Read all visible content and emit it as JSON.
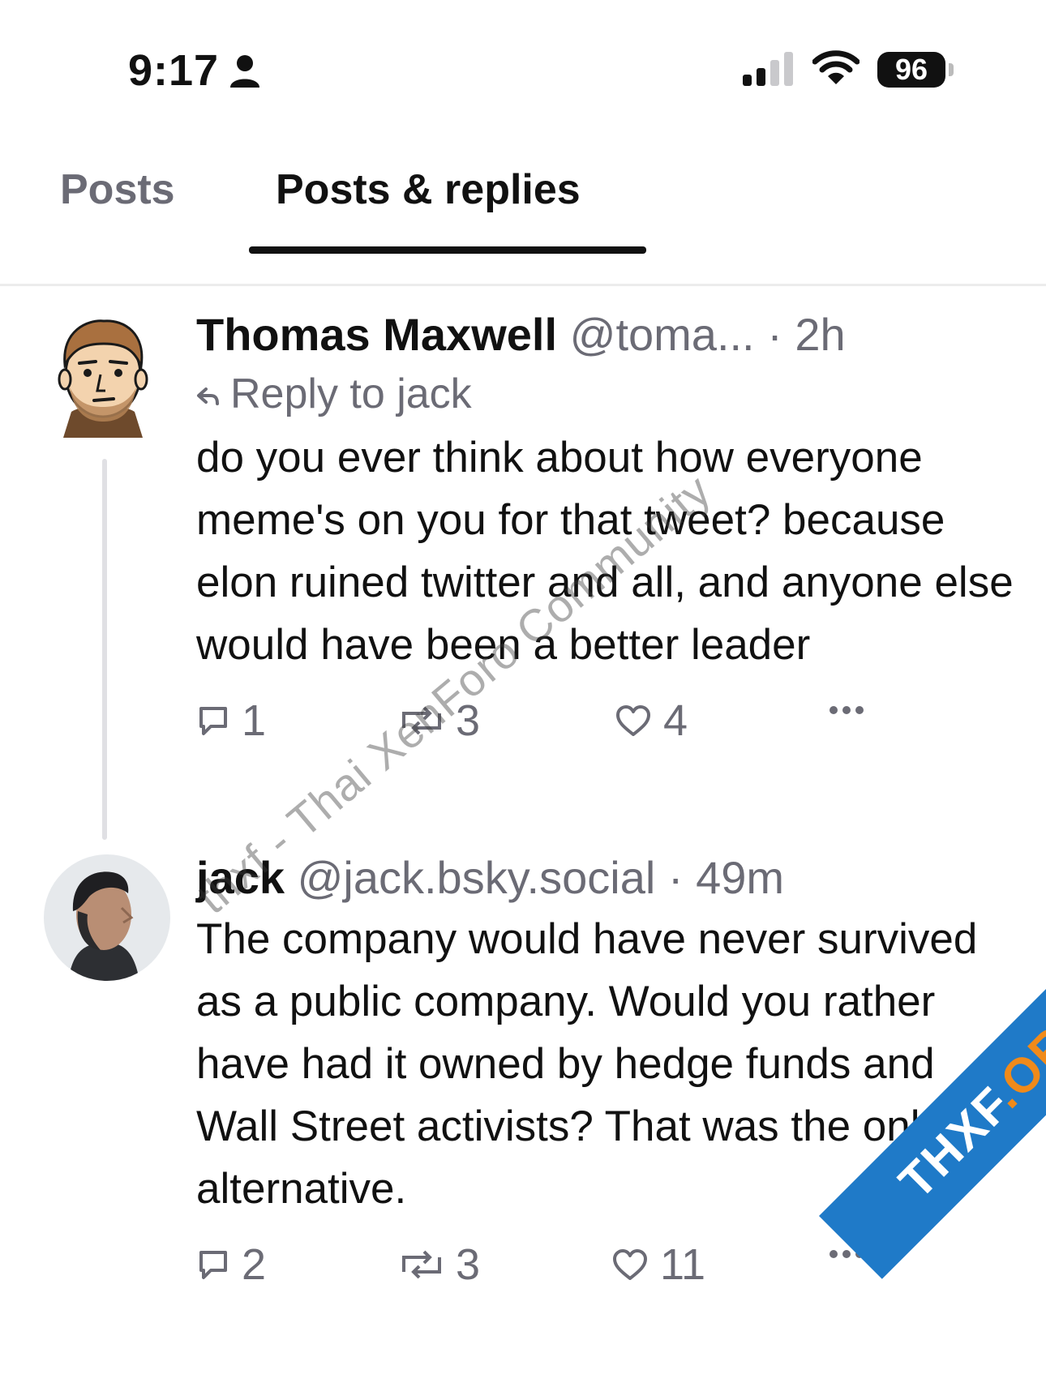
{
  "status_bar": {
    "time": "9:17",
    "battery": "96",
    "icons": [
      "person-icon",
      "signal-icon",
      "wifi-icon",
      "battery-icon"
    ]
  },
  "tabs": [
    {
      "label": "Posts",
      "active": false
    },
    {
      "label": "Posts & replies",
      "active": true
    }
  ],
  "posts": [
    {
      "author": "Thomas Maxwell",
      "handle": "@toma...",
      "separator": "·",
      "time": "2h",
      "reply_to": "Reply to jack",
      "text": "do you ever think about how everyone meme's on you for that tweet? because elon ruined twitter and all, and anyone else would have been a better leader",
      "replies": "1",
      "reposts": "3",
      "likes": "4"
    },
    {
      "author": "jack",
      "handle": "@jack.bsky.social",
      "separator": "·",
      "time": "49m",
      "text": "The company would have never survived as a public company. Would you rather have had it owned by hedge funds and Wall Street activists? That was the only alternative.",
      "replies": "2",
      "reposts": "3",
      "likes": "11"
    }
  ],
  "watermarks": {
    "diagonal": "thxf - Thai XenForo Community",
    "banner_main": "THXF",
    "banner_suffix": ".ORG"
  },
  "colors": {
    "text_primary": "#111111",
    "text_secondary": "#6b6b75",
    "banner": "#1f7ac8",
    "banner_accent": "#f08a1a"
  }
}
